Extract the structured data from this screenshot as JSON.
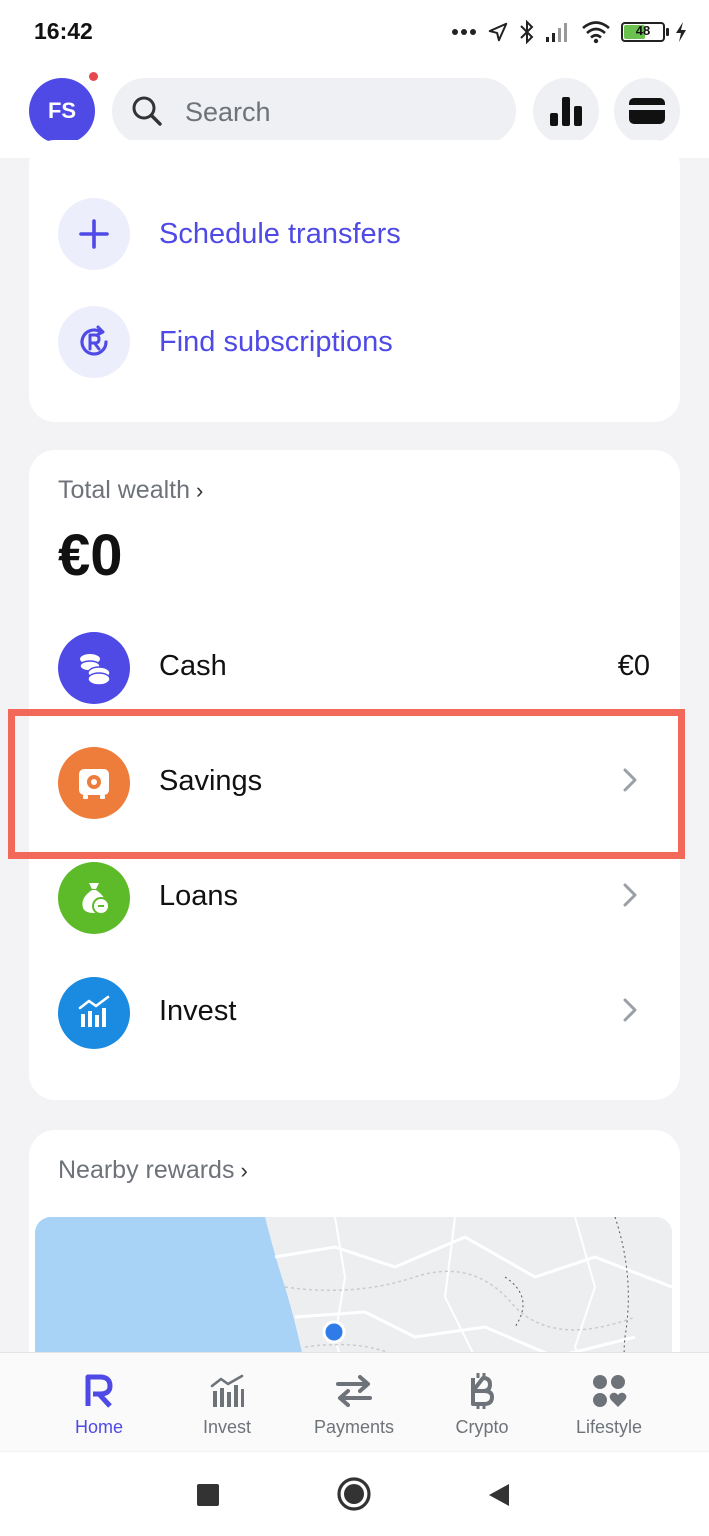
{
  "status_bar": {
    "time": "16:42",
    "battery_level": "48",
    "icons": [
      "more-dots-icon",
      "location-icon",
      "bluetooth-icon",
      "signal-icon",
      "wifi-icon",
      "battery-icon",
      "charging-icon"
    ]
  },
  "header": {
    "avatar_initials": "FS",
    "has_notification": true,
    "search_placeholder": "Search",
    "buttons": [
      "analytics-icon",
      "card-icon"
    ]
  },
  "quick_actions": [
    {
      "label": "Schedule transfers",
      "icon": "plus-icon"
    },
    {
      "label": "Find subscriptions",
      "icon": "subscription-icon"
    }
  ],
  "wealth": {
    "title": "Total wealth",
    "chevron": "›",
    "amount": "€0",
    "accounts": [
      {
        "label": "Cash",
        "value": "€0",
        "icon": "coins-icon",
        "color": "#4f4ae6"
      },
      {
        "label": "Savings",
        "icon": "vault-icon",
        "color": "#ee7c3b",
        "highlighted": true
      },
      {
        "label": "Loans",
        "icon": "money-bag-icon",
        "color": "#5dbb2a"
      },
      {
        "label": "Invest",
        "icon": "stocks-icon",
        "color": "#1a8be0"
      }
    ]
  },
  "rewards": {
    "title": "Nearby rewards",
    "chevron": "›"
  },
  "bottom_nav": [
    {
      "label": "Home",
      "icon": "revolut-r-icon",
      "active": true
    },
    {
      "label": "Invest",
      "icon": "stocks-icon",
      "active": false
    },
    {
      "label": "Payments",
      "icon": "transfer-arrows-icon",
      "active": false
    },
    {
      "label": "Crypto",
      "icon": "bitcoin-icon",
      "active": false
    },
    {
      "label": "Lifestyle",
      "icon": "lifestyle-icon",
      "active": false
    }
  ],
  "colors": {
    "accent": "#4f4ae6",
    "highlight_border": "#f26859",
    "savings": "#ee7c3b",
    "loans": "#5dbb2a",
    "invest": "#1a8be0"
  }
}
